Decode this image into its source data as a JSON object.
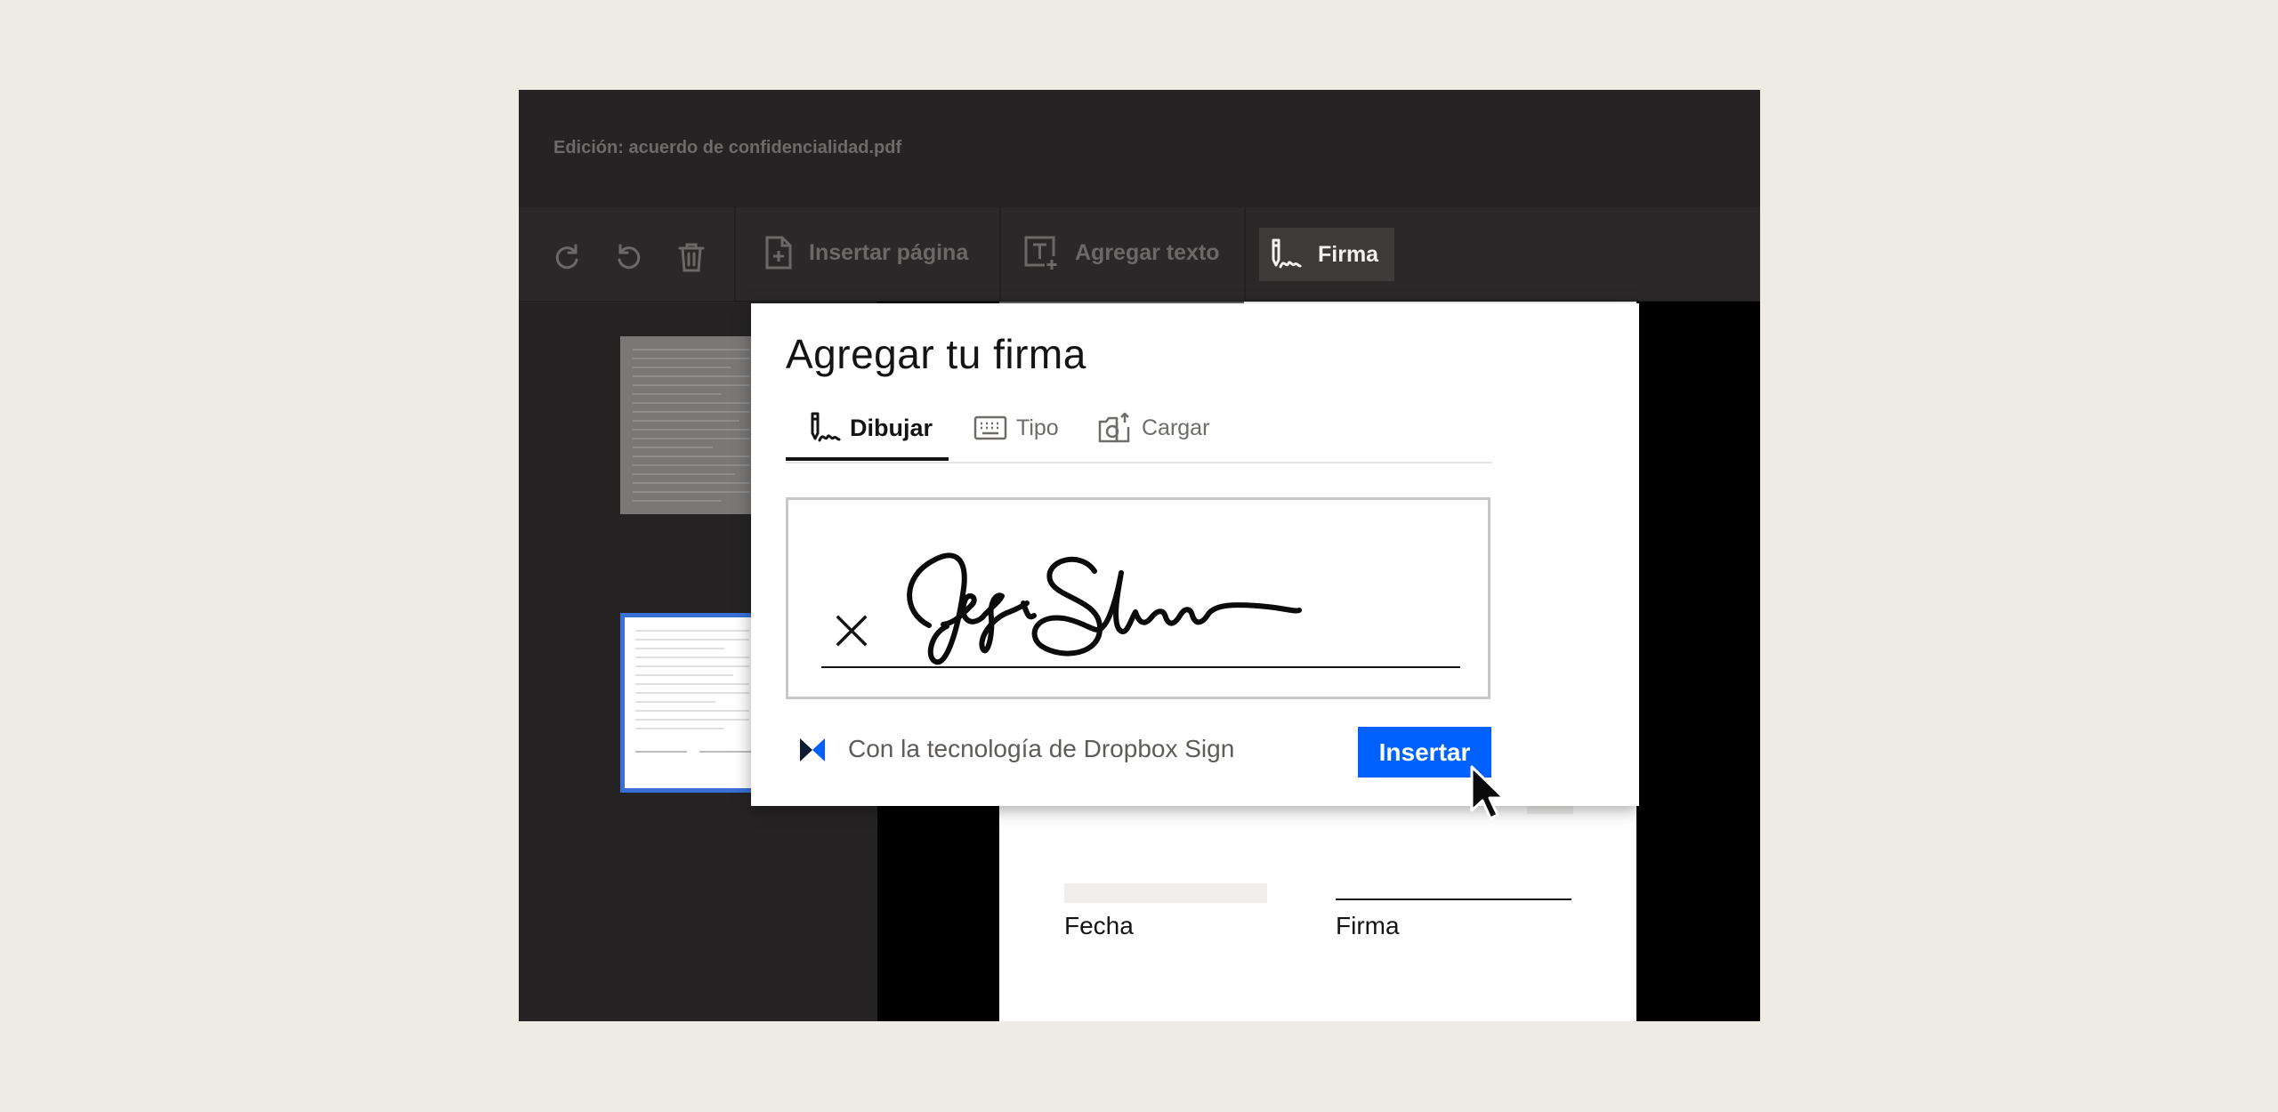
{
  "window": {
    "title": "Edición: acuerdo de confidencialidad.pdf"
  },
  "toolbar": {
    "redo_icon": "redo-icon",
    "undo_icon": "undo-icon",
    "delete_icon": "trash-icon",
    "insert_page_label": "Insertar página",
    "add_text_label": "Agregar texto",
    "signature_label": "Firma"
  },
  "document": {
    "date_label": "Fecha",
    "signature_label": "Firma"
  },
  "modal": {
    "title": "Agregar tu firma",
    "tabs": [
      {
        "label": "Dibujar",
        "icon": "pen-signature-icon",
        "active": true
      },
      {
        "label": "Tipo",
        "icon": "keyboard-icon",
        "active": false
      },
      {
        "label": "Cargar",
        "icon": "camera-upload-icon",
        "active": false
      }
    ],
    "footer_text": "Con la tecnología de Dropbox Sign",
    "insert_label": "Insertar"
  },
  "colors": {
    "accent": "#0061fe",
    "window_bg": "#262324",
    "page_bg": "#eeeae4",
    "selected_thumb_border": "#3a6fd8"
  }
}
